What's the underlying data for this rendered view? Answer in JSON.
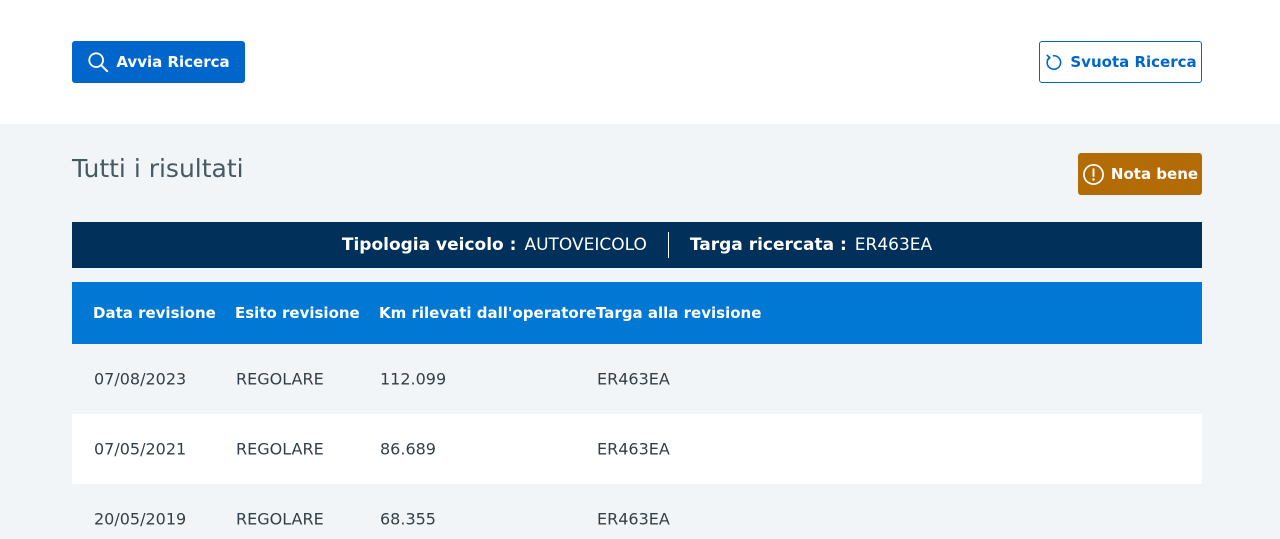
{
  "toolbar": {
    "search_label": "Avvia Ricerca",
    "reset_label": "Svuota Ricerca"
  },
  "results": {
    "title": "Tutti i risultati",
    "note_label": "Nota bene"
  },
  "vehicle": {
    "type_label": "Tipologia veicolo :",
    "type_value": "AUTOVEICOLO",
    "plate_label": "Targa ricercata :",
    "plate_value": "ER463EA"
  },
  "table": {
    "columns": [
      "Data revisione",
      "Esito revisione",
      "Km rilevati dall'operatore",
      "Targa alla revisione"
    ],
    "rows": [
      [
        "07/08/2023",
        "REGOLARE",
        "112.099",
        "ER463EA"
      ],
      [
        "07/05/2021",
        "REGOLARE",
        "86.689",
        "ER463EA"
      ],
      [
        "20/05/2019",
        "REGOLARE",
        "68.355",
        "ER463EA"
      ]
    ]
  },
  "colors": {
    "primary": "#0066cc",
    "header_bar": "#01305a",
    "table_header": "#0078d4",
    "warning": "#b36b05",
    "section_bg": "#f2f5f8"
  },
  "icons": {
    "search": "search-icon",
    "reset": "refresh-icon",
    "note": "alert-circle-icon"
  }
}
